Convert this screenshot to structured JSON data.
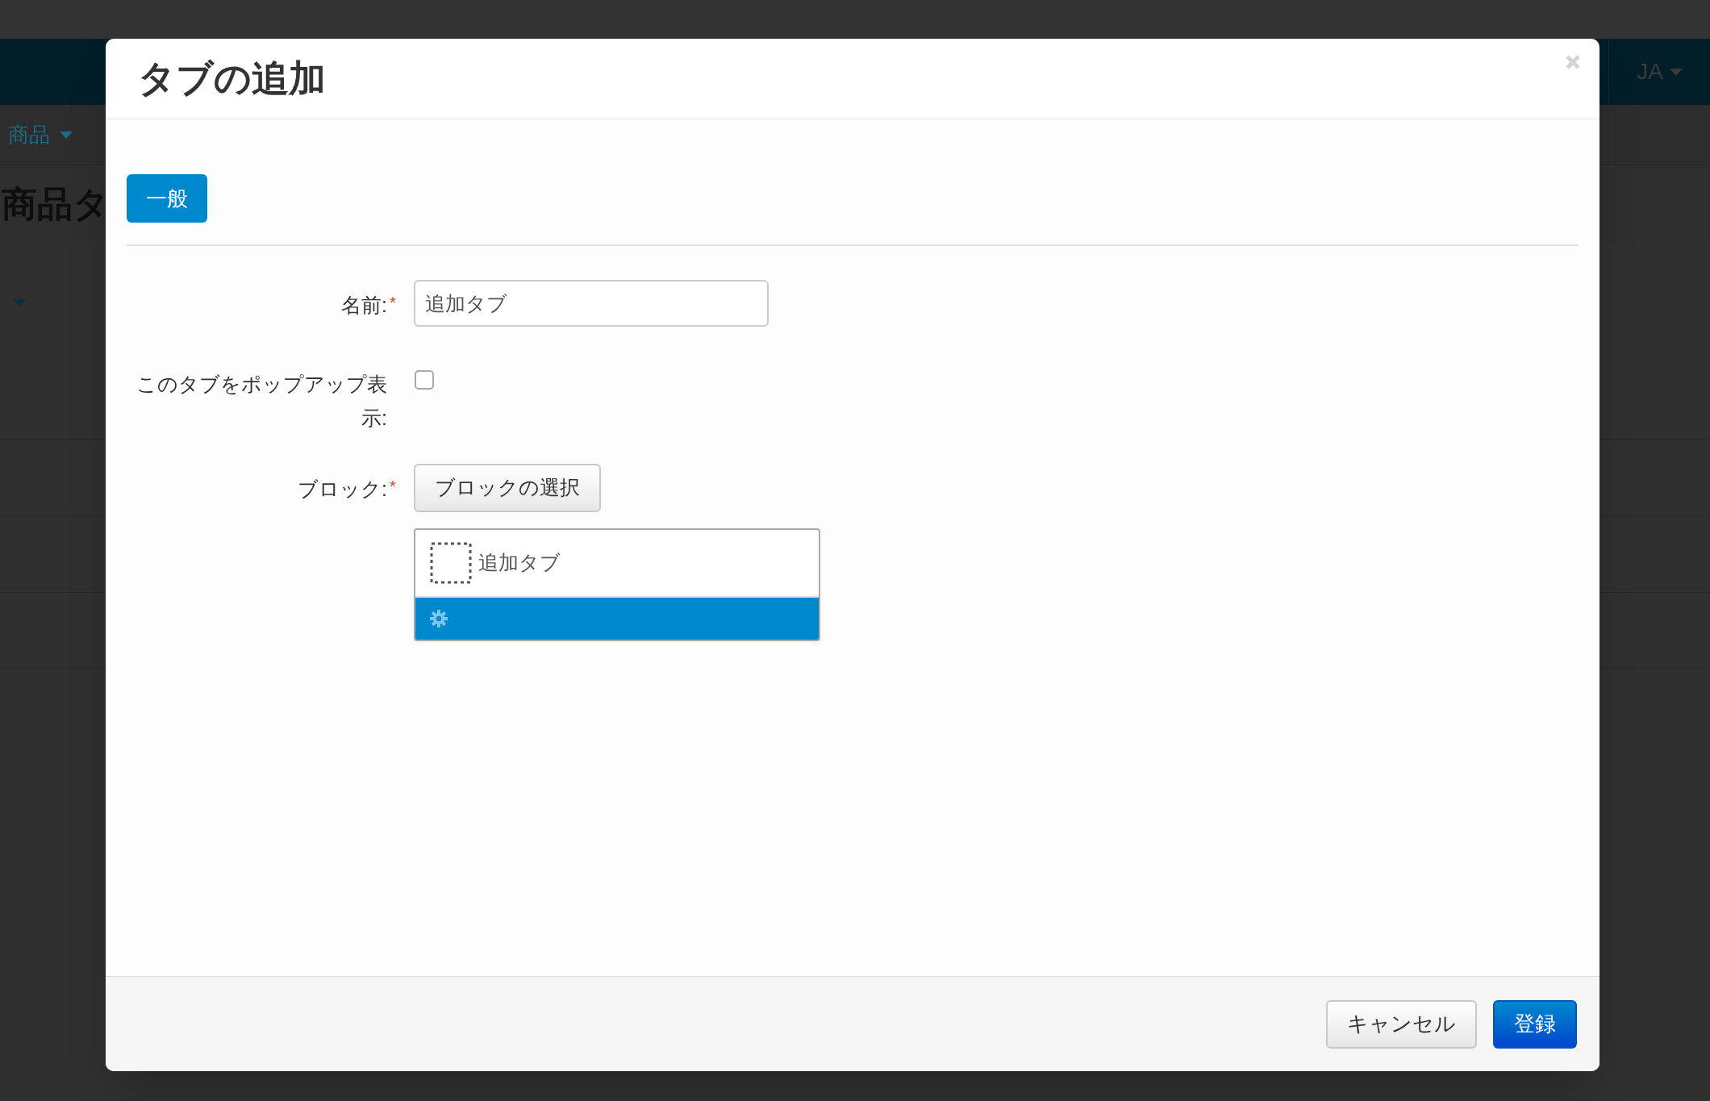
{
  "page": {
    "language_menu": "JA",
    "sub_nav": {
      "menu": "商品"
    },
    "heading": "商品タ"
  },
  "dialog": {
    "title": "タブの追加",
    "tabs": [
      {
        "label": "一般",
        "selected": true
      }
    ],
    "fields": [
      {
        "kind": "text",
        "label": "名前:",
        "required_mark": "*",
        "value": "追加タブ"
      },
      {
        "kind": "checkbox",
        "label": "このタブをポップアップ表示:",
        "checked": false
      },
      {
        "kind": "block_picker",
        "label": "ブロック:",
        "required_mark": "*",
        "button": "ブロックの選択",
        "blocks": [
          {
            "label": "追加タブ"
          }
        ]
      }
    ],
    "footer": {
      "buttons": [
        {
          "label": "キャンセル",
          "kind": "default"
        },
        {
          "label": "登録",
          "kind": "primary"
        }
      ]
    }
  }
}
